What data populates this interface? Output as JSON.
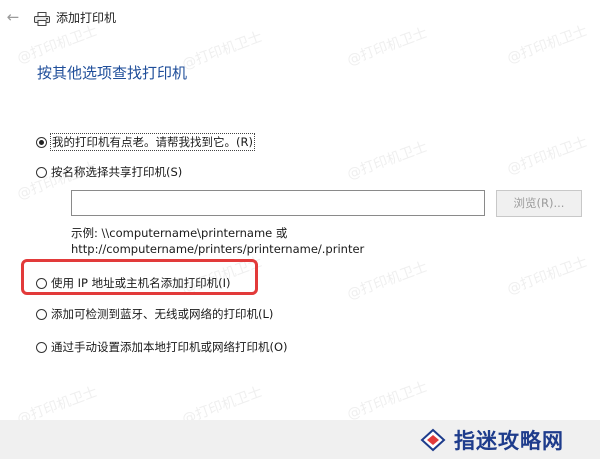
{
  "window": {
    "title": "添加打印机",
    "back_glyph": "←"
  },
  "heading": "按其他选项查找打印机",
  "options": [
    {
      "label": "我的打印机有点老。请帮我找到它。(R)",
      "checked": true
    },
    {
      "label": "按名称选择共享打印机(S)",
      "checked": false
    },
    {
      "label": "使用 IP 地址或主机名添加打印机(I)",
      "checked": false
    },
    {
      "label": "添加可检测到蓝牙、无线或网络的打印机(L)",
      "checked": false
    },
    {
      "label": "通过手动设置添加本地打印机或网络打印机(O)",
      "checked": false
    }
  ],
  "share_field": {
    "value": "",
    "browse_label": "浏览(R)..."
  },
  "example": {
    "line1": "示例: \\\\computername\\printername 或",
    "line2": "http://computername/printers/printername/.printer"
  },
  "watermark_text": "@打印机卫士",
  "site_logo": {
    "text": "指迷攻略网"
  },
  "colors": {
    "heading": "#1f4e9a",
    "highlight": "#e23a3a",
    "logo": "#1e3c8c"
  }
}
